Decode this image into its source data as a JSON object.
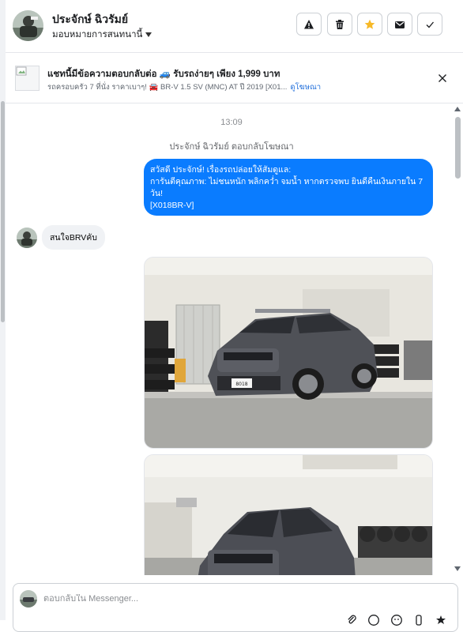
{
  "header": {
    "contact_name": "ประจักษ์ ฉิวรัมย์",
    "assign_label": "มอบหมายการสนทนานี้",
    "actions": [
      "report-icon",
      "trash-icon",
      "star-icon",
      "mail-icon",
      "check-icon"
    ],
    "star_color": "#f7b928"
  },
  "ad_banner": {
    "title": "แชทนี้มีข้อความตอบกลับต่อ 🚙 รับรถง่ายๆ เพียง 1,999 บาท",
    "subtitle": "รถครอบครัว 7 ที่นั่ง ราคาเบาๆ! 🚘 BR-V 1.5 SV (MNC) AT ปี 2019 [X01...",
    "link_label": "ดูโฆษณา"
  },
  "conversation": {
    "timestamp": "13:09",
    "reply_note": "ประจักษ์ ฉิวรัมย์ ตอบกลับโฆษณา",
    "outgoing_lines": [
      "สวัสดี ประจักษ์! เรื่องรถปล่อยให้สัมดูแล:",
      "การันตีคุณภาพ: ไม่ชนหนัก พลิกคว่ำ จมน้ำ หากตรวจพบ ยินดีคืนเงินภายใน 7",
      "วัน!",
      "[X018BR-V]"
    ],
    "incoming_message": "สนใจBRVคับ",
    "plate_text": "8018",
    "accent_color": "#0a7cff"
  },
  "composer": {
    "placeholder": "ตอบกลับใน Messenger...",
    "tools": [
      "attach-icon",
      "emoji-icon",
      "sticker-icon",
      "gif-icon",
      "like-icon"
    ]
  }
}
